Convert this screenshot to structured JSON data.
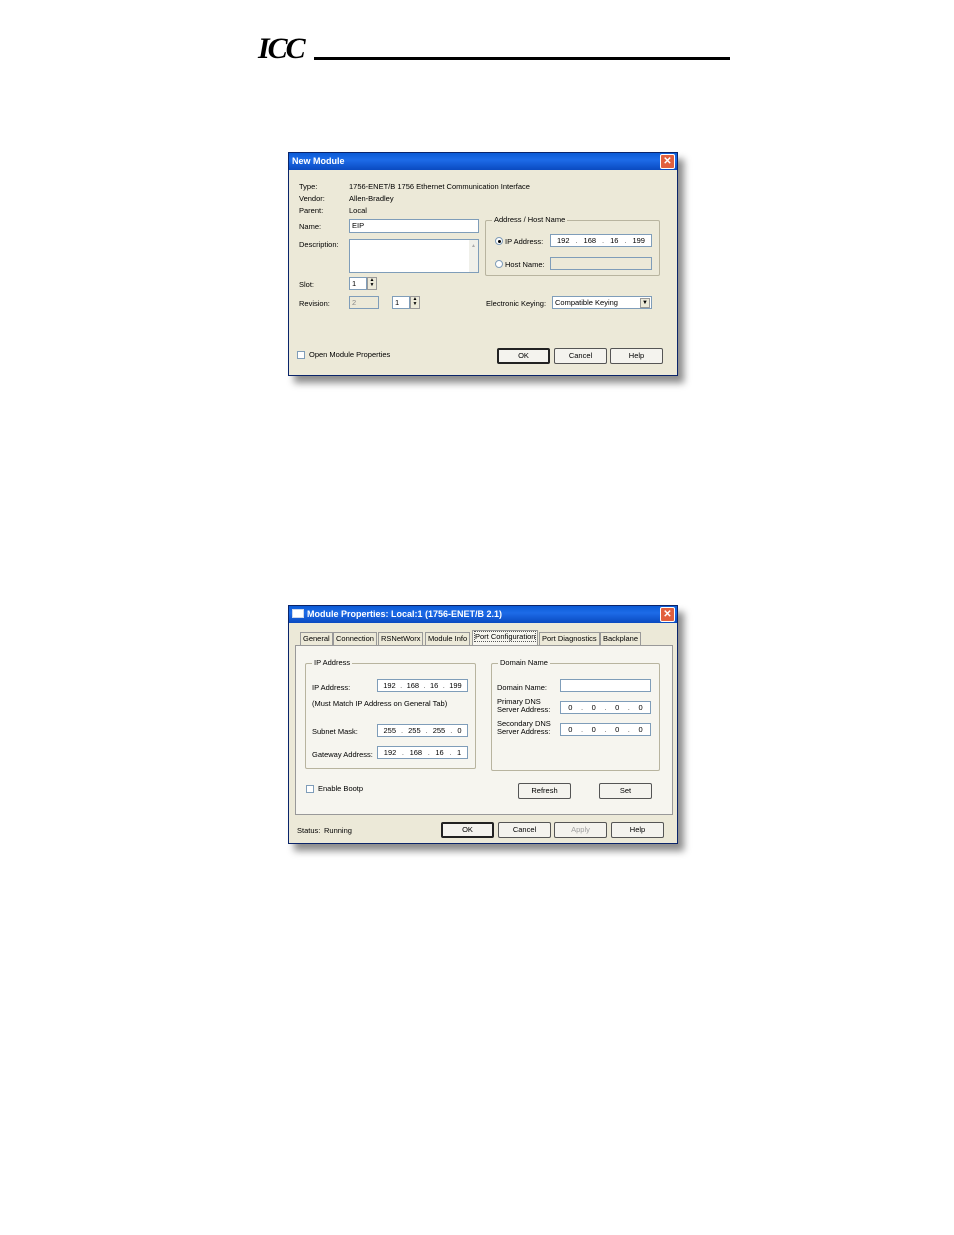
{
  "header": {
    "logo": "ICC"
  },
  "new_module": {
    "title": "New Module",
    "type_label": "Type:",
    "type_value": "1756-ENET/B 1756 Ethernet Communication Interface",
    "vendor_label": "Vendor:",
    "vendor_value": "Allen-Bradley",
    "parent_label": "Parent:",
    "parent_value": "Local",
    "name_label": "Name:",
    "name_value": "EIP",
    "description_label": "Description:",
    "description_value": "",
    "slot_label": "Slot:",
    "slot_value": "1",
    "revision_label": "Revision:",
    "revision_major": "2",
    "revision_minor": "1",
    "address_group_title": "Address / Host Name",
    "ip_radio_label": "IP Address:",
    "ip": [
      "192",
      "168",
      "16",
      "199"
    ],
    "host_radio_label": "Host Name:",
    "host_value": "",
    "keying_label": "Electronic Keying:",
    "keying_value": "Compatible Keying",
    "open_props_label": "Open Module Properties",
    "ok": "OK",
    "cancel": "Cancel",
    "help": "Help"
  },
  "module_props": {
    "title": "Module Properties: Local:1 (1756-ENET/B 2.1)",
    "tabs": [
      "General",
      "Connection",
      "RSNetWorx",
      "Module Info",
      "Port Configuration",
      "Port Diagnostics",
      "Backplane"
    ],
    "active_tab": "Port Configuration",
    "ip_group_title": "IP Address",
    "ip_label": "IP Address:",
    "ip": [
      "192",
      "168",
      "16",
      "199"
    ],
    "ip_note": "(Must Match IP Address on General Tab)",
    "subnet_label": "Subnet Mask:",
    "subnet": [
      "255",
      "255",
      "255",
      "0"
    ],
    "gateway_label": "Gateway Address:",
    "gateway": [
      "192",
      "168",
      "16",
      "1"
    ],
    "domain_group_title": "Domain Name",
    "domain_label": "Domain Name:",
    "domain_value": "",
    "primary_dns_label_1": "Primary DNS",
    "primary_dns_label_2": "Server Address:",
    "primary_dns": [
      "0",
      "0",
      "0",
      "0"
    ],
    "secondary_dns_label_1": "Secondary DNS",
    "secondary_dns_label_2": "Server Address:",
    "secondary_dns": [
      "0",
      "0",
      "0",
      "0"
    ],
    "bootp_label": "Enable Bootp",
    "refresh": "Refresh",
    "set": "Set",
    "status_label": "Status:",
    "status_value": "Running",
    "ok": "OK",
    "cancel": "Cancel",
    "apply": "Apply",
    "help": "Help"
  }
}
